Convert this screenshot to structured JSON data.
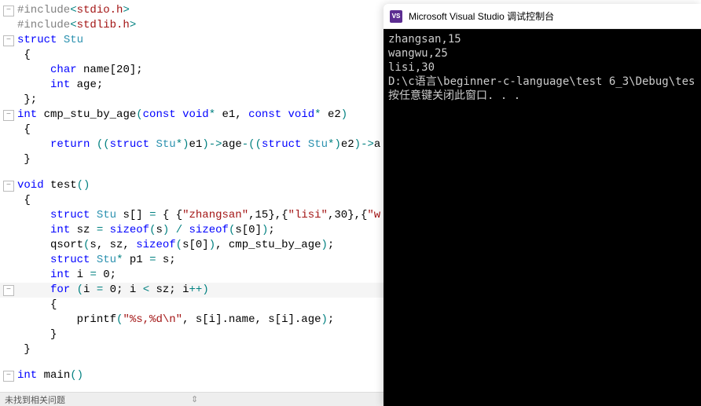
{
  "editor": {
    "lines": [
      {
        "gutter": "minus",
        "tokens": [
          {
            "c": "mac",
            "t": "#include"
          },
          {
            "c": "op",
            "t": "<"
          },
          {
            "c": "inc",
            "t": "stdio.h"
          },
          {
            "c": "op",
            "t": ">"
          }
        ]
      },
      {
        "gutter": "pipe",
        "tokens": [
          {
            "c": "mac",
            "t": "#include"
          },
          {
            "c": "op",
            "t": "<"
          },
          {
            "c": "inc",
            "t": "stdlib.h"
          },
          {
            "c": "op",
            "t": ">"
          }
        ]
      },
      {
        "gutter": "minus",
        "tokens": [
          {
            "c": "kw",
            "t": "struct"
          },
          {
            "c": "id",
            "t": " "
          },
          {
            "c": "struct",
            "t": "Stu"
          }
        ]
      },
      {
        "gutter": "space",
        "tokens": [
          {
            "c": "id",
            "t": " {"
          }
        ]
      },
      {
        "gutter": "space",
        "tokens": [
          {
            "c": "id",
            "t": "     "
          },
          {
            "c": "kw",
            "t": "char"
          },
          {
            "c": "id",
            "t": " name["
          },
          {
            "c": "num",
            "t": "20"
          },
          {
            "c": "id",
            "t": "];"
          }
        ]
      },
      {
        "gutter": "space",
        "tokens": [
          {
            "c": "id",
            "t": "     "
          },
          {
            "c": "kw",
            "t": "int"
          },
          {
            "c": "id",
            "t": " age;"
          }
        ]
      },
      {
        "gutter": "space",
        "tokens": [
          {
            "c": "id",
            "t": " };"
          }
        ]
      },
      {
        "gutter": "minus",
        "tokens": [
          {
            "c": "kw",
            "t": "int"
          },
          {
            "c": "id",
            "t": " "
          },
          {
            "c": "fn",
            "t": "cmp_stu_by_age"
          },
          {
            "c": "paren",
            "t": "("
          },
          {
            "c": "kw",
            "t": "const"
          },
          {
            "c": "id",
            "t": " "
          },
          {
            "c": "kw",
            "t": "void"
          },
          {
            "c": "op",
            "t": "*"
          },
          {
            "c": "id",
            "t": " e1, "
          },
          {
            "c": "kw",
            "t": "const"
          },
          {
            "c": "id",
            "t": " "
          },
          {
            "c": "kw",
            "t": "void"
          },
          {
            "c": "op",
            "t": "*"
          },
          {
            "c": "id",
            "t": " e2"
          },
          {
            "c": "paren",
            "t": ")"
          }
        ]
      },
      {
        "gutter": "space",
        "tokens": [
          {
            "c": "id",
            "t": " {"
          }
        ]
      },
      {
        "gutter": "space",
        "tokens": [
          {
            "c": "id",
            "t": "     "
          },
          {
            "c": "kw",
            "t": "return"
          },
          {
            "c": "id",
            "t": " "
          },
          {
            "c": "paren",
            "t": "(("
          },
          {
            "c": "kw",
            "t": "struct"
          },
          {
            "c": "id",
            "t": " "
          },
          {
            "c": "struct",
            "t": "Stu"
          },
          {
            "c": "op",
            "t": "*"
          },
          {
            "c": "paren",
            "t": ")"
          },
          {
            "c": "id",
            "t": "e1"
          },
          {
            "c": "paren",
            "t": ")"
          },
          {
            "c": "op",
            "t": "->"
          },
          {
            "c": "id",
            "t": "age"
          },
          {
            "c": "op",
            "t": "-"
          },
          {
            "c": "paren",
            "t": "(("
          },
          {
            "c": "kw",
            "t": "struct"
          },
          {
            "c": "id",
            "t": " "
          },
          {
            "c": "struct",
            "t": "Stu"
          },
          {
            "c": "op",
            "t": "*"
          },
          {
            "c": "paren",
            "t": ")"
          },
          {
            "c": "id",
            "t": "e2"
          },
          {
            "c": "paren",
            "t": ")"
          },
          {
            "c": "op",
            "t": "->"
          },
          {
            "c": "id",
            "t": "a"
          }
        ]
      },
      {
        "gutter": "space",
        "tokens": [
          {
            "c": "id",
            "t": " }"
          }
        ]
      },
      {
        "gutter": "blank",
        "tokens": [
          {
            "c": "id",
            "t": ""
          }
        ]
      },
      {
        "gutter": "minus",
        "tokens": [
          {
            "c": "kw",
            "t": "void"
          },
          {
            "c": "id",
            "t": " "
          },
          {
            "c": "fn",
            "t": "test"
          },
          {
            "c": "paren",
            "t": "()"
          }
        ]
      },
      {
        "gutter": "space",
        "tokens": [
          {
            "c": "id",
            "t": " {"
          }
        ]
      },
      {
        "gutter": "space",
        "tokens": [
          {
            "c": "id",
            "t": "     "
          },
          {
            "c": "kw",
            "t": "struct"
          },
          {
            "c": "id",
            "t": " "
          },
          {
            "c": "struct",
            "t": "Stu"
          },
          {
            "c": "id",
            "t": " s[] "
          },
          {
            "c": "op",
            "t": "="
          },
          {
            "c": "id",
            "t": " { {"
          },
          {
            "c": "str",
            "t": "\"zhangsan\""
          },
          {
            "c": "id",
            "t": ","
          },
          {
            "c": "num",
            "t": "15"
          },
          {
            "c": "id",
            "t": "},{"
          },
          {
            "c": "str",
            "t": "\"lisi\""
          },
          {
            "c": "id",
            "t": ","
          },
          {
            "c": "num",
            "t": "30"
          },
          {
            "c": "id",
            "t": "},{"
          },
          {
            "c": "str",
            "t": "\"w"
          }
        ]
      },
      {
        "gutter": "space",
        "tokens": [
          {
            "c": "id",
            "t": "     "
          },
          {
            "c": "kw",
            "t": "int"
          },
          {
            "c": "id",
            "t": " sz "
          },
          {
            "c": "op",
            "t": "="
          },
          {
            "c": "id",
            "t": " "
          },
          {
            "c": "sz",
            "t": "sizeof"
          },
          {
            "c": "paren",
            "t": "("
          },
          {
            "c": "id",
            "t": "s"
          },
          {
            "c": "paren",
            "t": ")"
          },
          {
            "c": "id",
            "t": " "
          },
          {
            "c": "op",
            "t": "/"
          },
          {
            "c": "id",
            "t": " "
          },
          {
            "c": "sz",
            "t": "sizeof"
          },
          {
            "c": "paren",
            "t": "("
          },
          {
            "c": "id",
            "t": "s["
          },
          {
            "c": "num",
            "t": "0"
          },
          {
            "c": "id",
            "t": "]"
          },
          {
            "c": "paren",
            "t": ")"
          },
          {
            "c": "id",
            "t": ";"
          }
        ]
      },
      {
        "gutter": "space",
        "tokens": [
          {
            "c": "id",
            "t": "     qsort"
          },
          {
            "c": "paren",
            "t": "("
          },
          {
            "c": "id",
            "t": "s, sz, "
          },
          {
            "c": "sz",
            "t": "sizeof"
          },
          {
            "c": "paren",
            "t": "("
          },
          {
            "c": "id",
            "t": "s["
          },
          {
            "c": "num",
            "t": "0"
          },
          {
            "c": "id",
            "t": "]"
          },
          {
            "c": "paren",
            "t": ")"
          },
          {
            "c": "id",
            "t": ", cmp_stu_by_age"
          },
          {
            "c": "paren",
            "t": ")"
          },
          {
            "c": "id",
            "t": ";"
          }
        ]
      },
      {
        "gutter": "space",
        "tokens": [
          {
            "c": "id",
            "t": "     "
          },
          {
            "c": "kw",
            "t": "struct"
          },
          {
            "c": "id",
            "t": " "
          },
          {
            "c": "struct",
            "t": "Stu"
          },
          {
            "c": "op",
            "t": "*"
          },
          {
            "c": "id",
            "t": " p1 "
          },
          {
            "c": "op",
            "t": "="
          },
          {
            "c": "id",
            "t": " s;"
          }
        ]
      },
      {
        "gutter": "space",
        "tokens": [
          {
            "c": "id",
            "t": "     "
          },
          {
            "c": "kw",
            "t": "int"
          },
          {
            "c": "id",
            "t": " i "
          },
          {
            "c": "op",
            "t": "="
          },
          {
            "c": "id",
            "t": " "
          },
          {
            "c": "num",
            "t": "0"
          },
          {
            "c": "id",
            "t": ";"
          }
        ]
      },
      {
        "gutter": "minus",
        "hl": true,
        "tokens": [
          {
            "c": "id",
            "t": "     "
          },
          {
            "c": "kw",
            "t": "for"
          },
          {
            "c": "id",
            "t": " "
          },
          {
            "c": "paren",
            "t": "("
          },
          {
            "c": "id",
            "t": "i "
          },
          {
            "c": "op",
            "t": "="
          },
          {
            "c": "id",
            "t": " "
          },
          {
            "c": "num",
            "t": "0"
          },
          {
            "c": "id",
            "t": "; i "
          },
          {
            "c": "op",
            "t": "<"
          },
          {
            "c": "id",
            "t": " sz; i"
          },
          {
            "c": "op",
            "t": "++"
          },
          {
            "c": "paren",
            "t": ")"
          }
        ]
      },
      {
        "gutter": "space",
        "tokens": [
          {
            "c": "id",
            "t": "     {"
          }
        ]
      },
      {
        "gutter": "space",
        "tokens": [
          {
            "c": "id",
            "t": "         printf"
          },
          {
            "c": "paren",
            "t": "("
          },
          {
            "c": "str",
            "t": "\"%s,%d\\n\""
          },
          {
            "c": "id",
            "t": ", s[i].name, s[i].age"
          },
          {
            "c": "paren",
            "t": ")"
          },
          {
            "c": "id",
            "t": ";"
          }
        ]
      },
      {
        "gutter": "space",
        "tokens": [
          {
            "c": "id",
            "t": "     }"
          }
        ]
      },
      {
        "gutter": "space",
        "tokens": [
          {
            "c": "id",
            "t": " }"
          }
        ]
      },
      {
        "gutter": "blank",
        "tokens": [
          {
            "c": "id",
            "t": ""
          }
        ]
      },
      {
        "gutter": "minus",
        "tokens": [
          {
            "c": "kw",
            "t": "int"
          },
          {
            "c": "id",
            "t": " "
          },
          {
            "c": "fn",
            "t": "main"
          },
          {
            "c": "paren",
            "t": "()"
          }
        ]
      }
    ]
  },
  "status_text": "未找到相关问题",
  "console": {
    "title": "Microsoft Visual Studio 调试控制台",
    "icon_text": "VS",
    "output": [
      "zhangsan,15",
      "wangwu,25",
      "lisi,30",
      "",
      "D:\\c语言\\beginner-c-language\\test 6_3\\Debug\\tes",
      "按任意键关闭此窗口. . ."
    ]
  }
}
